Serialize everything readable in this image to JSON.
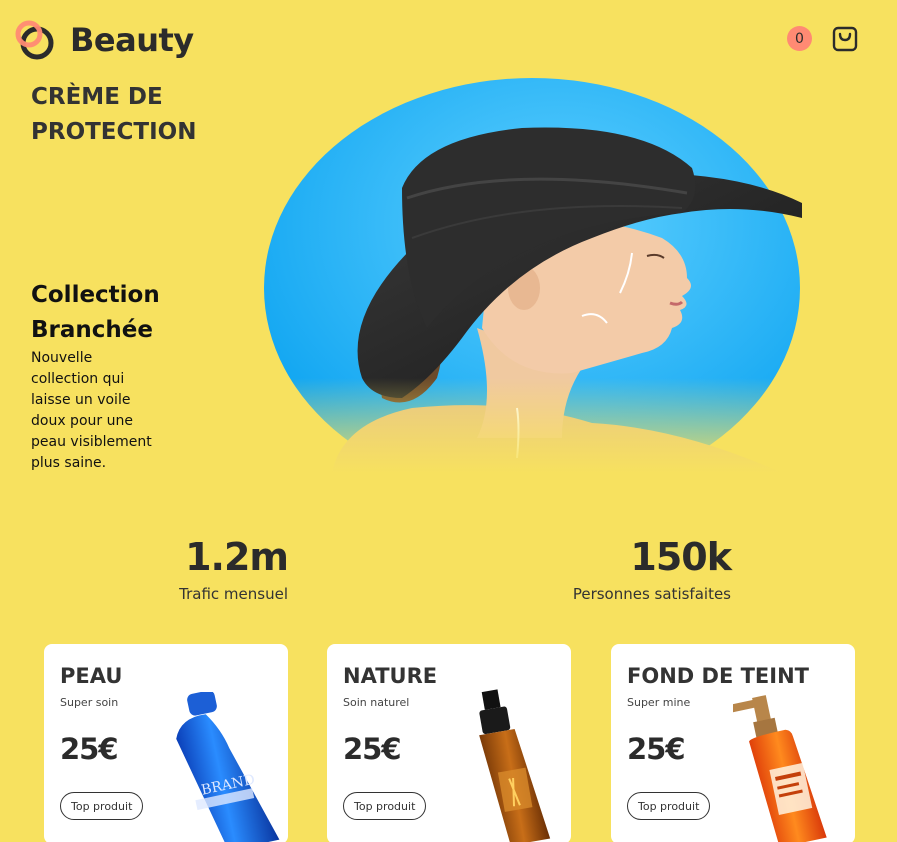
{
  "header": {
    "brand": "Beauty",
    "cart_count": "0"
  },
  "hero": {
    "title": "CRÈME DE PROTECTION",
    "collection_title": "Collection Branchée",
    "collection_desc": "Nouvelle collection qui laisse un voile doux pour une peau visiblement plus saine."
  },
  "stats": [
    {
      "value": "1.2m",
      "label": "Trafic mensuel"
    },
    {
      "value": "150k",
      "label": "Personnes satisfaites"
    }
  ],
  "products": [
    {
      "title": "PEAU",
      "subtitle": "Super soin",
      "price": "25€",
      "button": "Top produit"
    },
    {
      "title": "NATURE",
      "subtitle": "Soin naturel",
      "price": "25€",
      "button": "Top produit"
    },
    {
      "title": "FOND DE TEINT",
      "subtitle": "Super mine",
      "price": "25€",
      "button": "Top produit"
    }
  ],
  "colors": {
    "background": "#f7e15f",
    "accent": "#ff8a73",
    "hero_circle": "#2aaef5",
    "card": "#ffffff",
    "text": "#2b2b2b"
  },
  "icons": {
    "logo": "logo-rings-icon",
    "cart": "shopping-bag-icon"
  }
}
